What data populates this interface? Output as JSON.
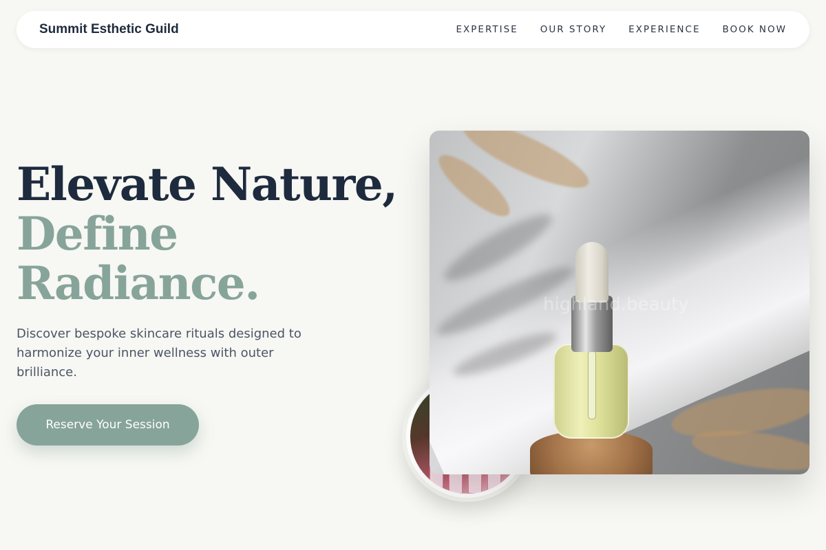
{
  "nav": {
    "brand": "Summit Esthetic Guild",
    "links": [
      "EXPERTISE",
      "OUR STORY",
      "EXPERIENCE",
      "BOOK NOW"
    ]
  },
  "hero": {
    "title_line1": "Elevate Nature,",
    "title_line2": "Define",
    "title_line3": "Radiance.",
    "subtitle": "Discover bespoke skincare rituals designed to harmonize your inner wellness with outer brilliance.",
    "cta_label": "Reserve Your Session"
  },
  "images": {
    "watermark": "highland.beauty"
  },
  "colors": {
    "background": "#f7f7f3",
    "text_dark": "#1e2a3d",
    "accent": "#87a49a",
    "body_text": "#4a5566"
  }
}
